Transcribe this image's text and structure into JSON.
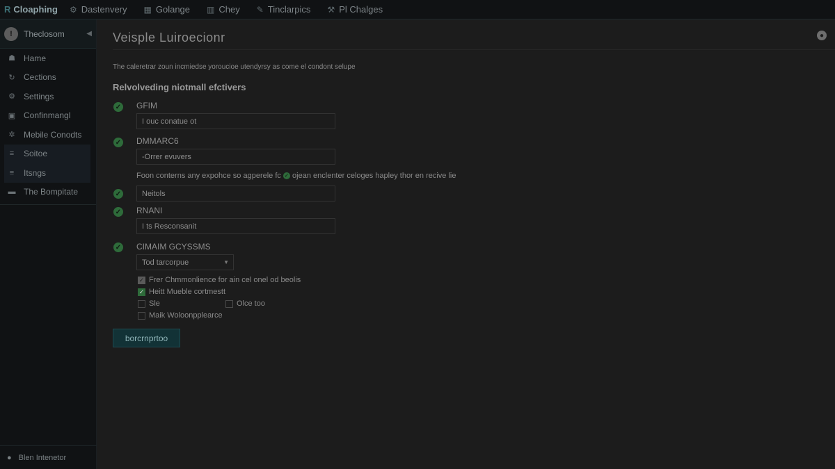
{
  "topnav": {
    "brand": "Cloaphing",
    "brand_icon": "R",
    "items": [
      {
        "label": "Dastenvery",
        "icon": "settings-icon"
      },
      {
        "label": "Golange",
        "icon": "grid-icon"
      },
      {
        "label": "Chey",
        "icon": "chart-icon"
      },
      {
        "label": "Tinclarpics",
        "icon": "brush-icon"
      },
      {
        "label": "Pl Chalges",
        "icon": "tools-icon"
      }
    ]
  },
  "sidebar": {
    "header": {
      "badge": "!",
      "label": "Theclosom"
    },
    "items": [
      {
        "label": "Hame",
        "icon": "users-icon"
      },
      {
        "label": "Cections",
        "icon": "refresh-icon"
      },
      {
        "label": "Settings",
        "icon": "gear-icon"
      },
      {
        "label": "Confinmangl",
        "icon": "lock-icon"
      },
      {
        "label": "Mebile Conodts",
        "icon": "network-icon"
      },
      {
        "label": "Soitoe",
        "icon": "list-icon"
      },
      {
        "label": "Itsngs",
        "icon": "list-icon"
      },
      {
        "label": "The Bompitate",
        "icon": "folder-icon"
      }
    ],
    "footer": {
      "label": "Blen Intenetor",
      "icon": "chat-icon"
    }
  },
  "main": {
    "title": "Veisple Luiroecionr",
    "description": "The caleretrar zoun incmiedse yoroucioe utendyrsy as come el condont selupe",
    "section_heading": "Relvolveding niotmall efctivers",
    "fields": [
      {
        "label": "GFIM",
        "value": "I ouc conatue ot"
      },
      {
        "label": "DMMARC6",
        "value": "-Orrer evuvers"
      },
      {
        "label": "",
        "value": "Neitols"
      },
      {
        "label": "RNANI",
        "value": "I ts Resconsanit"
      }
    ],
    "note_before": "Foon conterns any expohce so agperele fc",
    "note_after": "ojean enclenter celoges hapley thor en recive lie",
    "select_label": "CIMAIM GCYSSMS",
    "select_value": "Tod tarcorpue",
    "checkboxes": [
      {
        "label": "Frer Chmmonlience for ain cel onel od beolis",
        "checked": true
      },
      {
        "label": "Heitt Mueble cortmestt",
        "checked": true
      },
      {
        "label": "Sle",
        "checked": false
      },
      {
        "label": "Olce too",
        "checked": false
      },
      {
        "label": "Maik Woloonpplearce",
        "checked": false
      }
    ],
    "submit_label": "borcrnprtoo"
  }
}
